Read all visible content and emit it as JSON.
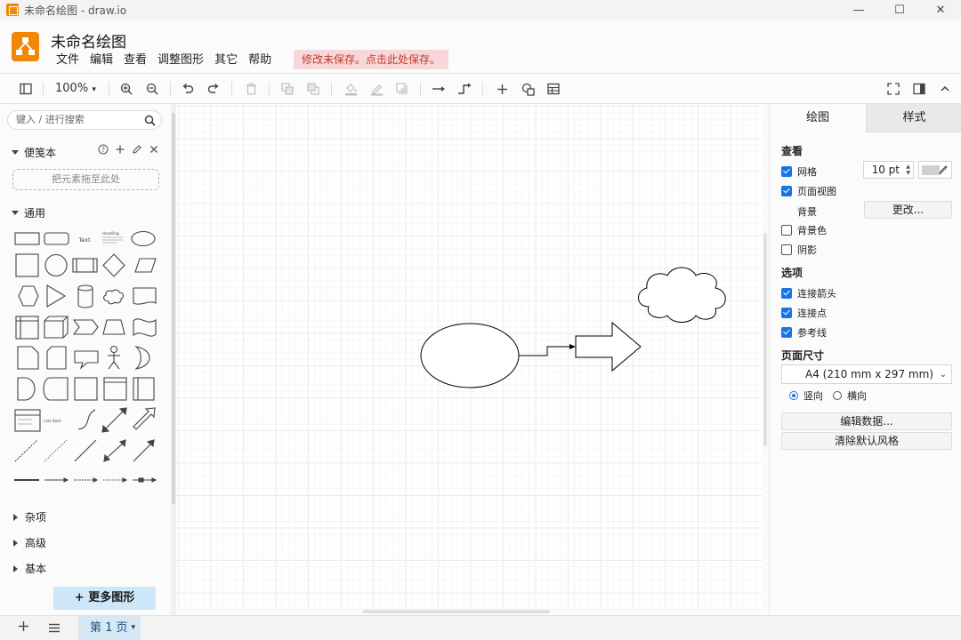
{
  "window": {
    "title": "未命名绘图 - draw.io",
    "min_glyph": "—",
    "max_glyph": "☐",
    "close_glyph": "✕"
  },
  "header": {
    "doc_title": "未命名绘图",
    "menus": [
      "文件",
      "编辑",
      "查看",
      "调整图形",
      "其它",
      "帮助"
    ],
    "save_warning": "修改未保存。点击此处保存。"
  },
  "toolbar": {
    "zoom": "100%"
  },
  "sidebar": {
    "search_placeholder": "键入 / 进行搜索",
    "scratchpad_title": "便笺本",
    "scratchpad_drop": "把元素拖至此处",
    "general_title": "通用",
    "shape_text": "Text",
    "shape_heading": "Heading",
    "shape_list_item": "List item",
    "collapsed_sections": [
      "杂项",
      "高级",
      "基本"
    ],
    "more_shapes": "+ 更多图形"
  },
  "right_panel": {
    "tabs": [
      "绘图",
      "样式"
    ],
    "view_title": "查看",
    "grid_label": "网格",
    "grid_checked": true,
    "grid_size": "10 pt",
    "grid_color": "#d0d0d0",
    "page_view_label": "页面视图",
    "page_view_checked": true,
    "background_label": "背景",
    "change_button": "更改...",
    "bg_color_label": "背景色",
    "bg_color_checked": false,
    "shadow_label": "阴影",
    "shadow_checked": false,
    "options_title": "选项",
    "connection_arrows_label": "连接箭头",
    "connection_arrows_checked": true,
    "connection_points_label": "连接点",
    "connection_points_checked": true,
    "guides_label": "参考线",
    "guides_checked": true,
    "paper_size_title": "页面尺寸",
    "paper_size_value": "A4 (210 mm x 297 mm)",
    "orientation_portrait": "竖向",
    "orientation_landscape": "横向",
    "orientation_selected": "portrait",
    "edit_data_button": "编辑数据...",
    "clear_style_button": "清除默认风格"
  },
  "bottom": {
    "page_tab": "第 1 页"
  },
  "colors": {
    "brand": "#f08705",
    "accent": "#1a73e8",
    "warning_bg": "#f8d7da",
    "warning_text": "#c0392b",
    "page_tab_bg": "#d7e8f5",
    "more_shapes_bg": "#cde7f9"
  },
  "diagram_shapes": [
    "ellipse",
    "connector-arrow",
    "block-arrow",
    "cloud"
  ]
}
